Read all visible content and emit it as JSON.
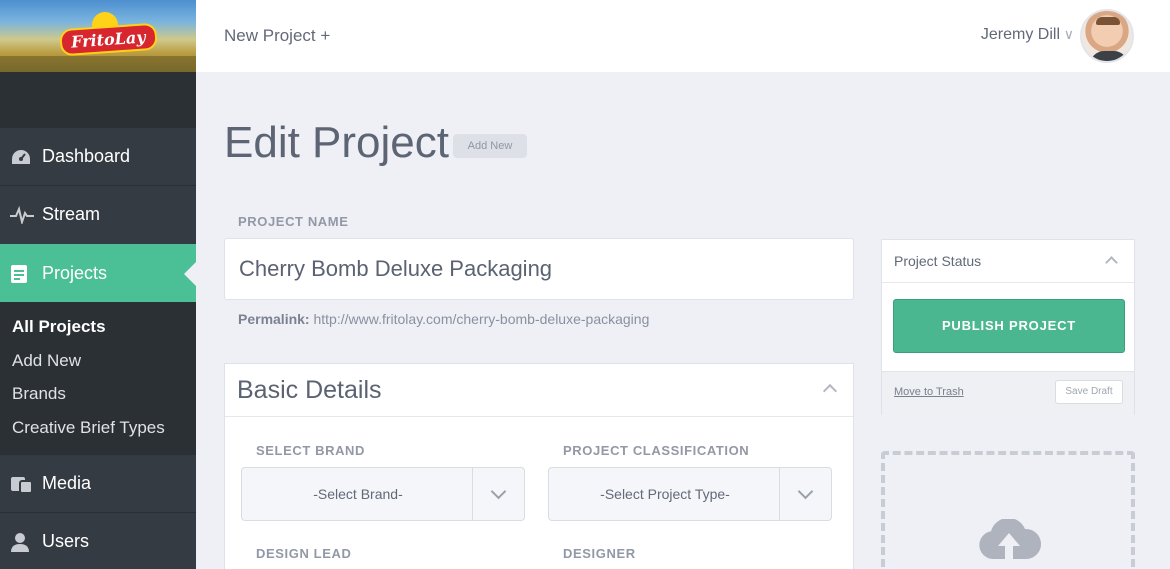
{
  "brand": {
    "logo_text": "FritoLay"
  },
  "sidebar": {
    "items": [
      {
        "label": "Dashboard",
        "icon": "dashboard-gauge-icon"
      },
      {
        "label": "Stream",
        "icon": "pulse-icon"
      },
      {
        "label": "Projects",
        "icon": "document-icon",
        "active": true
      },
      {
        "label": "Media",
        "icon": "media-icon"
      },
      {
        "label": "Users",
        "icon": "user-icon"
      }
    ],
    "submenu": [
      {
        "label": "All Projects",
        "active": true
      },
      {
        "label": "Add New"
      },
      {
        "label": "Brands"
      },
      {
        "label": "Creative Brief Types"
      }
    ]
  },
  "topbar": {
    "new_project": "New Project +",
    "user_name": "Jeremy Dill"
  },
  "main": {
    "title": "Edit Project",
    "add_new_badge": "Add New",
    "project_name_label": "PROJECT NAME",
    "project_name_value": "Cherry Bomb Deluxe Packaging",
    "permalink_label": "Permalink:",
    "permalink_url": "http://www.fritolay.com/cherry-bomb-deluxe-packaging",
    "basic_details": {
      "title": "Basic Details",
      "select_brand_label": "SELECT BRAND",
      "select_brand_value": "-Select Brand-",
      "classification_label": "PROJECT CLASSIFICATION",
      "classification_value": "-Select Project Type-",
      "design_lead_label": "DESIGN LEAD",
      "designer_label": "DESIGNER"
    }
  },
  "status": {
    "title": "Project Status",
    "publish_label": "PUBLISH PROJECT",
    "trash_label": "Move to Trash",
    "save_draft_label": "Save Draft"
  },
  "colors": {
    "accent": "#4bbf95",
    "sidebar": "#353b42",
    "publish": "#4bb791"
  }
}
